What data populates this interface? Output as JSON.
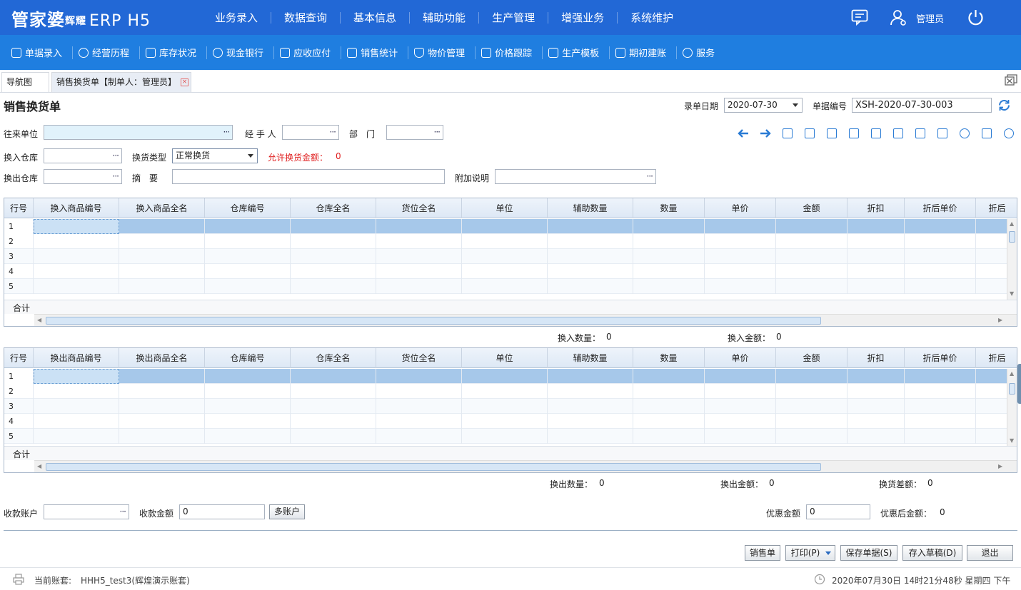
{
  "brand": {
    "logo_cn": "管家婆",
    "logo_sub": "辉耀",
    "logo_erp": "ERP H5",
    "accent": "#2268d6",
    "subbar_color": "#1f7ee0"
  },
  "main_nav": [
    "业务录入",
    "数据查询",
    "基本信息",
    "辅助功能",
    "生产管理",
    "增强业务",
    "系统维护"
  ],
  "user": {
    "name": "管理员"
  },
  "sub_nav": [
    {
      "label": "单据录入",
      "icon": "edit-icon"
    },
    {
      "label": "经营历程",
      "icon": "check-circle-icon"
    },
    {
      "label": "库存状况",
      "icon": "inventory-icon"
    },
    {
      "label": "现金银行",
      "icon": "yen-icon"
    },
    {
      "label": "应收应付",
      "icon": "receivable-icon"
    },
    {
      "label": "销售统计",
      "icon": "sales-stats-icon"
    },
    {
      "label": "物价管理",
      "icon": "price-shield-icon"
    },
    {
      "label": "价格跟踪",
      "icon": "price-track-icon"
    },
    {
      "label": "生产模板",
      "icon": "template-icon"
    },
    {
      "label": "期初建账",
      "icon": "opening-account-icon"
    },
    {
      "label": "服务",
      "icon": "help-icon"
    }
  ],
  "tabs": [
    {
      "label": "导航图",
      "active": false
    },
    {
      "label": "销售换货单【制单人：管理员】",
      "active": true,
      "closable": true
    }
  ],
  "form": {
    "title": "销售换货单",
    "date_label": "录单日期",
    "date_value": "2020-07-30",
    "no_label": "单据编号",
    "no_value": "XSH-2020-07-30-003",
    "partner_label": "往来单位",
    "handler_label": "经 手 人",
    "dept_label": "部　门",
    "in_wh_label": "换入仓库",
    "type_label": "换货类型",
    "type_value": "正常换货",
    "allow_label": "允许换货金额：",
    "allow_value": "0",
    "out_wh_label": "换出仓库",
    "summary_label": "摘　要",
    "extra_label": "附加说明",
    "dots": "···"
  },
  "toolbar_icons": [
    "arrow-left-icon",
    "arrow-right-icon",
    "barcode-icon",
    "stamp-icon",
    "settings-icon",
    "copy-icon",
    "save-doc-icon",
    "number-icon",
    "floppy-icon",
    "exchange-icon",
    "user-icon",
    "folder-icon",
    "help-icon"
  ],
  "grid_in": {
    "columns": [
      "行号",
      "换入商品编号",
      "换入商品全名",
      "仓库编号",
      "仓库全名",
      "货位全名",
      "单位",
      "辅助数量",
      "数量",
      "单价",
      "金额",
      "折扣",
      "折后单价",
      "折后"
    ],
    "rows": [
      "1",
      "2",
      "3",
      "4",
      "5"
    ],
    "sum_label": "合计",
    "qty_label": "换入数量：",
    "qty_value": "0",
    "amt_label": "换入金额：",
    "amt_value": "0"
  },
  "grid_out": {
    "columns": [
      "行号",
      "换出商品编号",
      "换出商品全名",
      "仓库编号",
      "仓库全名",
      "货位全名",
      "单位",
      "辅助数量",
      "数量",
      "单价",
      "金额",
      "折扣",
      "折后单价",
      "折后"
    ],
    "rows": [
      "1",
      "2",
      "3",
      "4",
      "5"
    ],
    "sum_label": "合计",
    "qty_label": "换出数量：",
    "qty_value": "0",
    "amt_label": "换出金额：",
    "amt_value": "0",
    "diff_label": "换货差额：",
    "diff_value": "0"
  },
  "payment": {
    "account_label": "收款账户",
    "amount_label": "收款金额",
    "amount_value": "0",
    "multi_button": "多账户",
    "discount_label": "优惠金额",
    "discount_value": "0",
    "after_label": "优惠后金额：",
    "after_value": "0"
  },
  "actions": {
    "sales": "销售单",
    "print": "打印(P)",
    "save": "保存单据(S)",
    "draft": "存入草稿(D)",
    "exit": "退出"
  },
  "footer": {
    "account_label": "当前账套:",
    "account_value": "HHH5_test3(辉煌演示账套)",
    "datetime": "2020年07月30日 14时21分48秒 星期四 下午"
  }
}
